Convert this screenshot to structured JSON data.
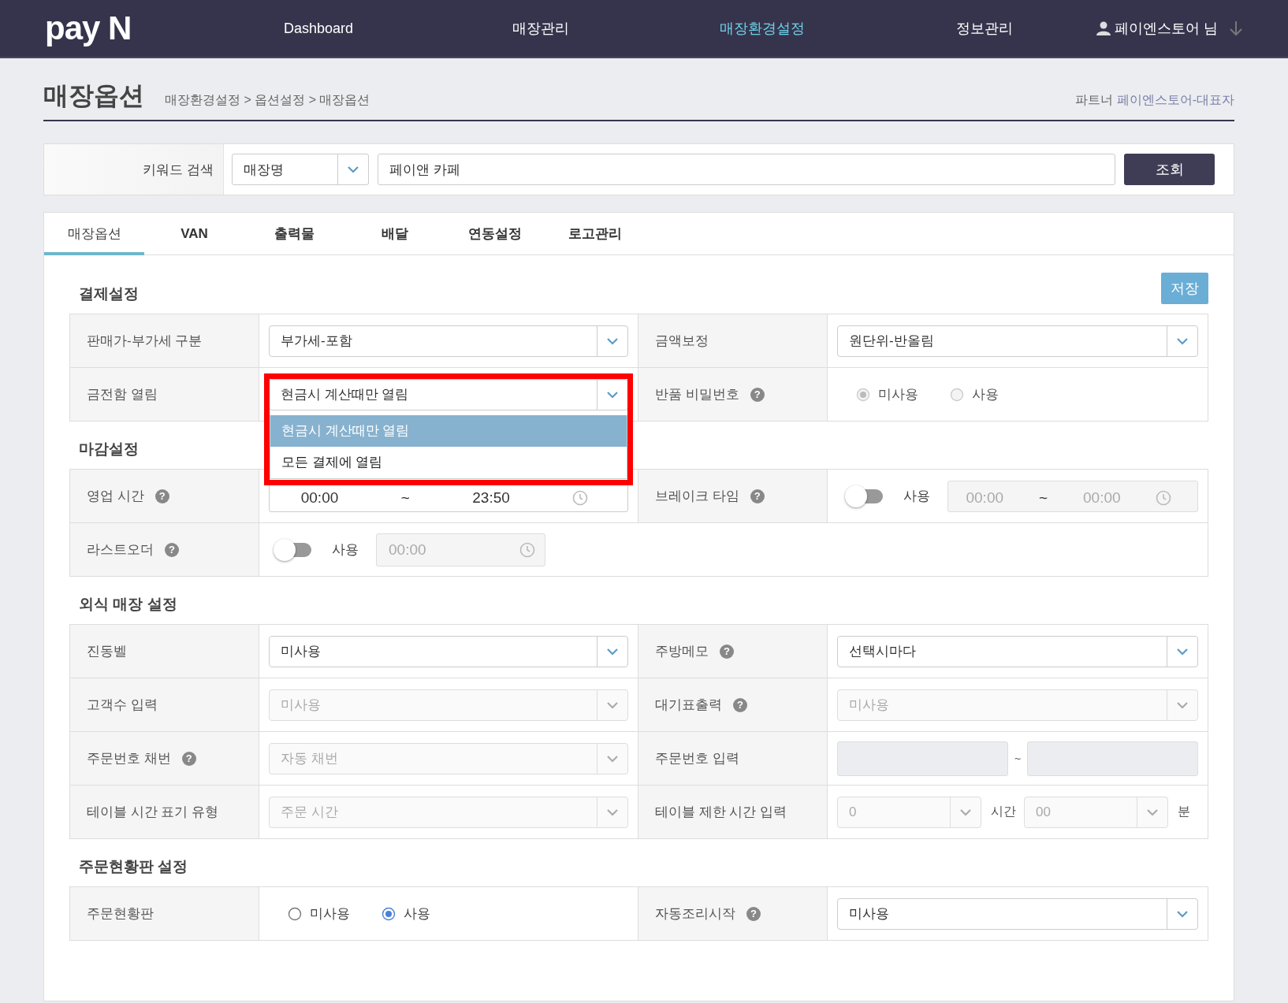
{
  "header": {
    "logo": "pay N",
    "nav": [
      {
        "label": "Dashboard",
        "selected": false
      },
      {
        "label": "매장관리",
        "selected": false
      },
      {
        "label": "매장환경설정",
        "selected": true
      },
      {
        "label": "정보관리",
        "selected": false
      }
    ],
    "user": "페이엔스토어 님"
  },
  "page": {
    "title": "매장옵션",
    "breadcrumb": "매장환경설정 > 옵션설정 > 매장옵션",
    "partner_label": "파트너",
    "partner_name": "페이엔스토어-대표자"
  },
  "search": {
    "label": "키워드 검색",
    "field": "매장명",
    "value": "페이앤 카페",
    "button": "조회"
  },
  "tabs": [
    {
      "label": "매장옵션",
      "selected": true
    },
    {
      "label": "VAN",
      "selected": false
    },
    {
      "label": "출력물",
      "selected": false
    },
    {
      "label": "배달",
      "selected": false
    },
    {
      "label": "연동설정",
      "selected": false
    },
    {
      "label": "로고관리",
      "selected": false
    }
  ],
  "save_button": "저장",
  "sections": [
    {
      "title": "결제설정",
      "rows": [
        {
          "cells": [
            {
              "label": "판매가-부가세 구분",
              "control": {
                "kind": "select",
                "value": "부가세-포함",
                "disabled": false
              }
            },
            {
              "label": "금액보정",
              "control": {
                "kind": "select",
                "value": "원단위-반올림",
                "disabled": false
              }
            }
          ]
        },
        {
          "cells": [
            {
              "label": "금전함 열림",
              "control": {
                "kind": "select",
                "value": "현금시 계산때만 열림",
                "disabled": false,
                "open": true,
                "highlighted": true,
                "options": [
                  {
                    "label": "현금시 계산때만 열림",
                    "selected": true
                  },
                  {
                    "label": "모든 결제에 열림",
                    "selected": false
                  }
                ]
              }
            },
            {
              "label": "반품 비밀번호",
              "help": "?",
              "control": {
                "kind": "radio",
                "disabled": true,
                "options": [
                  {
                    "label": "미사용",
                    "selected": true
                  },
                  {
                    "label": "사용",
                    "selected": false
                  }
                ]
              }
            }
          ]
        }
      ]
    },
    {
      "title": "마감설정",
      "rows": [
        {
          "cells": [
            {
              "label": "영업 시간",
              "help": "?",
              "control": {
                "kind": "time_range",
                "from": "00:00",
                "separator": "~",
                "to": "23:50",
                "disabled": false
              }
            },
            {
              "label": "브레이크 타임",
              "help": "?",
              "control": {
                "kind": "toggle_time_range",
                "on": false,
                "toggle_label": "사용",
                "from": "00:00",
                "separator": "~",
                "to": "00:00",
                "disabled": true
              }
            }
          ]
        },
        {
          "cells": [
            {
              "label": "라스트오더",
              "help": "?",
              "control": {
                "kind": "toggle_time",
                "on": false,
                "toggle_label": "사용",
                "time": "00:00",
                "disabled": true
              }
            }
          ]
        }
      ]
    },
    {
      "title": "외식 매장 설정",
      "rows": [
        {
          "cells": [
            {
              "label": "진동벨",
              "control": {
                "kind": "select",
                "value": "미사용",
                "disabled": false
              }
            },
            {
              "label": "주방메모",
              "help": "?",
              "control": {
                "kind": "select",
                "value": "선택시마다",
                "disabled": false
              }
            }
          ]
        },
        {
          "cells": [
            {
              "label": "고객수 입력",
              "control": {
                "kind": "select",
                "value": "미사용",
                "disabled": true
              }
            },
            {
              "label": "대기표출력",
              "help": "?",
              "control": {
                "kind": "select",
                "value": "미사용",
                "disabled": true
              }
            }
          ]
        },
        {
          "cells": [
            {
              "label": "주문번호 채번",
              "help": "?",
              "control": {
                "kind": "select",
                "value": "자동 채번",
                "disabled": true
              }
            },
            {
              "label": "주문번호 입력",
              "control": {
                "kind": "range_input",
                "separator": "~",
                "disabled": true
              }
            }
          ]
        },
        {
          "cells": [
            {
              "label": "테이블 시간 표기 유형",
              "control": {
                "kind": "select",
                "value": "주문 시간",
                "disabled": true
              }
            },
            {
              "label": "테이블 제한 시간 입력",
              "control": {
                "kind": "duration",
                "disabled": true,
                "parts": [
                  {
                    "value": "0",
                    "unit": "시간"
                  },
                  {
                    "value": "00",
                    "unit": "분"
                  }
                ]
              }
            }
          ]
        }
      ]
    },
    {
      "title": "주문현황판 설정",
      "rows": [
        {
          "cells": [
            {
              "label": "주문현황판",
              "control": {
                "kind": "radio",
                "disabled": false,
                "options": [
                  {
                    "label": "미사용",
                    "selected": false
                  },
                  {
                    "label": "사용",
                    "selected": true
                  }
                ]
              }
            },
            {
              "label": "자동조리시작",
              "help": "?",
              "control": {
                "kind": "select",
                "value": "미사용",
                "disabled": false
              }
            }
          ]
        }
      ]
    }
  ]
}
